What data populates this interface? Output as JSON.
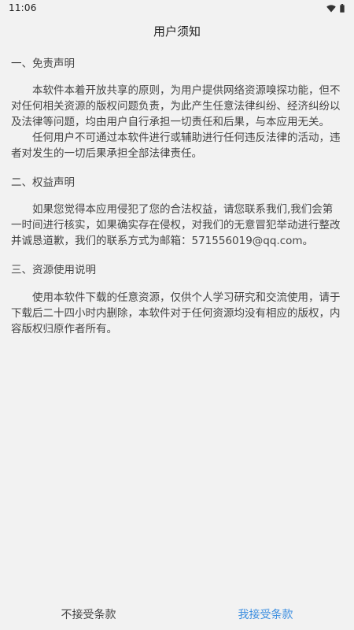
{
  "status_bar": {
    "time": "11:06",
    "icons": [
      "wifi-icon",
      "battery-icon"
    ]
  },
  "header": {
    "title": "用户须知"
  },
  "sections": [
    {
      "heading": "一、免责声明",
      "paragraphs": [
        "本软件本着开放共享的原则，为用户提供网络资源嗅探功能，但不对任何相关资源的版权问题负责，为此产生任意法律纠纷、经济纠纷以及法律等问题，均由用户自行承担一切责任和后果，与本应用无关。",
        "任何用户不可通过本软件进行或辅助进行任何违反法律的活动，违者对发生的一切后果承担全部法律责任。"
      ]
    },
    {
      "heading": "二、权益声明",
      "paragraphs": [
        "如果您觉得本应用侵犯了您的合法权益，请您联系我们,我们会第一时间进行核实，如果确实存在侵权，对我们的无意冒犯举动进行整改并诚恳道歉，我们的联系方式为邮箱：571556019@qq.com。"
      ]
    },
    {
      "heading": "三、资源使用说明",
      "paragraphs": [
        "使用本软件下载的任意资源，仅供个人学习研究和交流使用，请于下载后二十四小时内删除，本软件对于任何资源均没有相应的版权，内容版权归原作者所有。"
      ]
    }
  ],
  "footer": {
    "decline_label": "不接受条款",
    "accept_label": "我接受条款"
  },
  "colors": {
    "background": "#f2f2f2",
    "text": "#444444",
    "accent": "#3d8fe0"
  }
}
